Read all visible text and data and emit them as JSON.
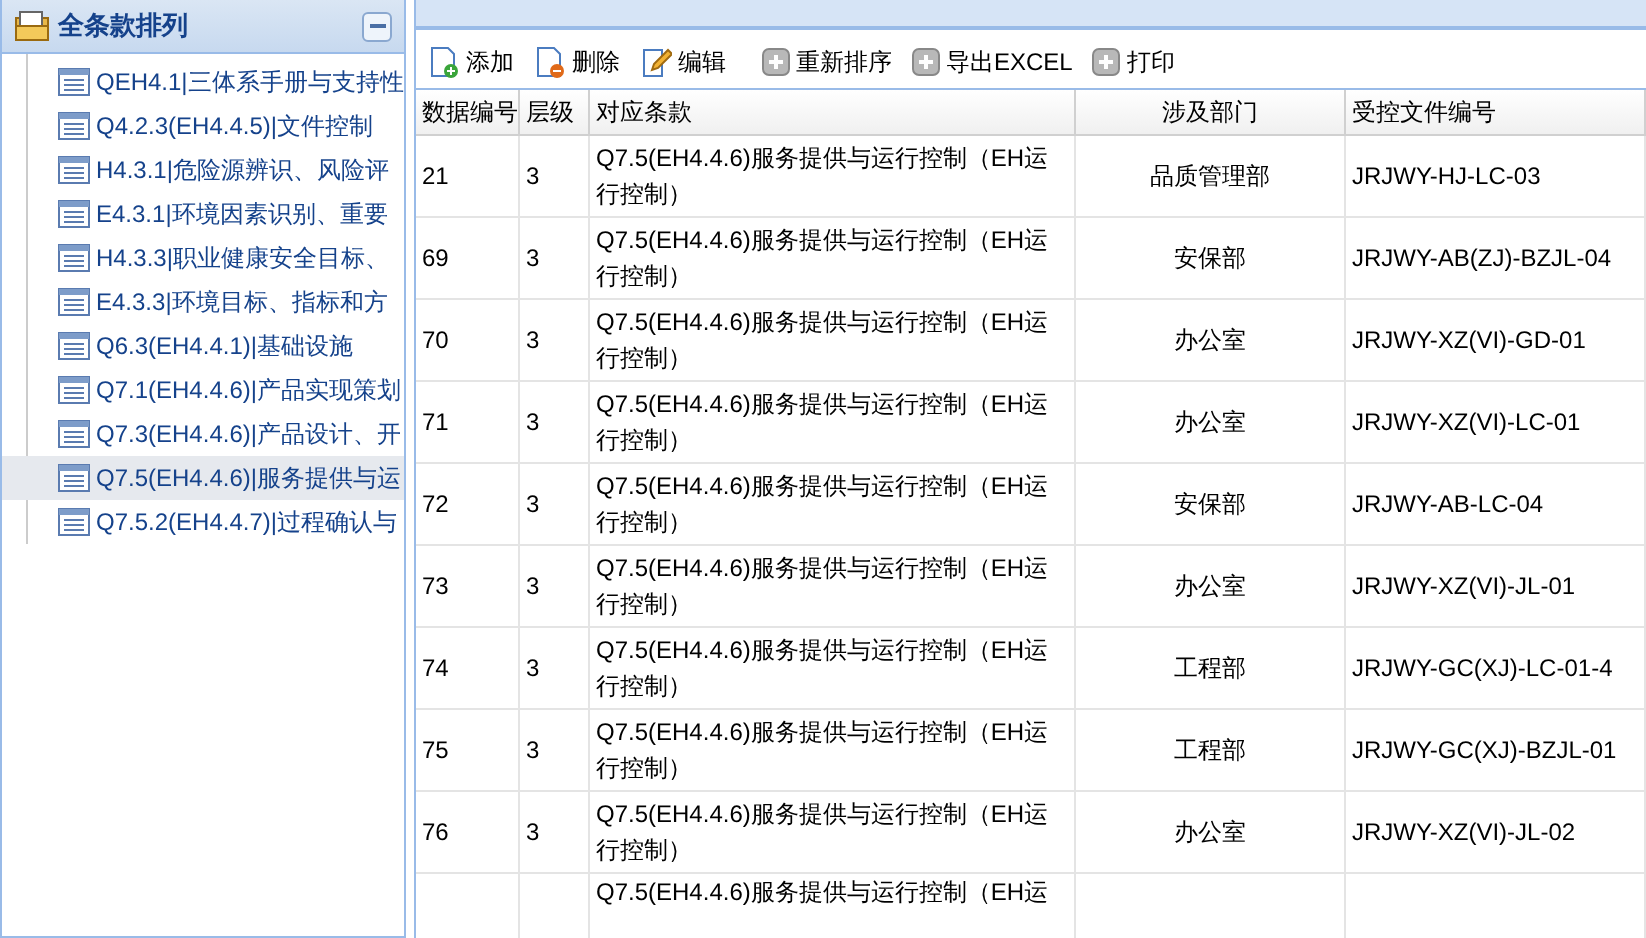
{
  "tree": {
    "title": "全条款排列",
    "expanded": true,
    "items": [
      {
        "label": "QEH4.1|三体系手册与支持性",
        "selected": false
      },
      {
        "label": "Q4.2.3(EH4.4.5)|文件控制",
        "selected": false
      },
      {
        "label": "H4.3.1|危险源辨识、风险评",
        "selected": false
      },
      {
        "label": "E4.3.1|环境因素识别、重要",
        "selected": false
      },
      {
        "label": "H4.3.3|职业健康安全目标、",
        "selected": false
      },
      {
        "label": "E4.3.3|环境目标、指标和方",
        "selected": false
      },
      {
        "label": "Q6.3(EH4.4.1)|基础设施",
        "selected": false
      },
      {
        "label": "Q7.1(EH4.4.6)|产品实现策划",
        "selected": false
      },
      {
        "label": "Q7.3(EH4.4.6)|产品设计、开",
        "selected": false
      },
      {
        "label": "Q7.5(EH4.4.6)|服务提供与运",
        "selected": true
      },
      {
        "label": "Q7.5.2(EH4.4.7)|过程确认与",
        "selected": false
      }
    ]
  },
  "toolbar": [
    {
      "label": "添加",
      "kind": "add"
    },
    {
      "label": "删除",
      "kind": "delete"
    },
    {
      "label": "编辑",
      "kind": "edit"
    },
    {
      "label": "重新排序",
      "kind": "plain"
    },
    {
      "label": "导出EXCEL",
      "kind": "plain"
    },
    {
      "label": "打印",
      "kind": "plain"
    }
  ],
  "table": {
    "columns": [
      "数据编号",
      "层级",
      "对应条款",
      "涉及部门",
      "受控文件编号"
    ],
    "rows": [
      [
        "21",
        "3",
        "Q7.5(EH4.4.6)服务提供与运行控制（EH运行控制）",
        "品质管理部",
        "JRJWY-HJ-LC-03"
      ],
      [
        "69",
        "3",
        "Q7.5(EH4.4.6)服务提供与运行控制（EH运行控制）",
        "安保部",
        "JRJWY-AB(ZJ)-BZJL-04"
      ],
      [
        "70",
        "3",
        "Q7.5(EH4.4.6)服务提供与运行控制（EH运行控制）",
        "办公室",
        "JRJWY-XZ(VI)-GD-01"
      ],
      [
        "71",
        "3",
        "Q7.5(EH4.4.6)服务提供与运行控制（EH运行控制）",
        "办公室",
        "JRJWY-XZ(VI)-LC-01"
      ],
      [
        "72",
        "3",
        "Q7.5(EH4.4.6)服务提供与运行控制（EH运行控制）",
        "安保部",
        "JRJWY-AB-LC-04"
      ],
      [
        "73",
        "3",
        "Q7.5(EH4.4.6)服务提供与运行控制（EH运行控制）",
        "办公室",
        "JRJWY-XZ(VI)-JL-01"
      ],
      [
        "74",
        "3",
        "Q7.5(EH4.4.6)服务提供与运行控制（EH运行控制）",
        "工程部",
        "JRJWY-GC(XJ)-LC-01-4"
      ],
      [
        "75",
        "3",
        "Q7.5(EH4.4.6)服务提供与运行控制（EH运行控制）",
        "工程部",
        "JRJWY-GC(XJ)-BZJL-01"
      ],
      [
        "76",
        "3",
        "Q7.5(EH4.4.6)服务提供与运行控制（EH运行控制）",
        "办公室",
        "JRJWY-XZ(VI)-JL-02"
      ],
      [
        "",
        "",
        "Q7.5(EH4.4.6)服务提供与运行控制（EH运",
        "",
        ""
      ]
    ]
  }
}
